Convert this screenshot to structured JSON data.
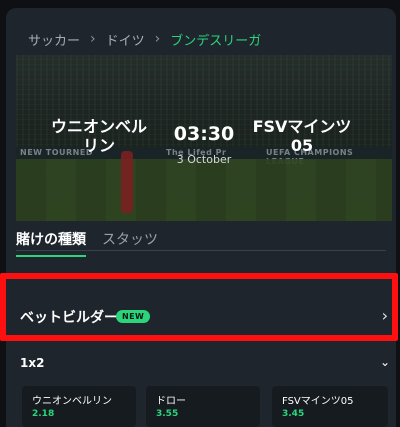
{
  "breadcrumb": {
    "items": [
      "サッカー",
      "ドイツ",
      "ブンデスリーガ"
    ],
    "separator": "›"
  },
  "match": {
    "home_team_line1": "ウニオンベル",
    "home_team_line2": "リン",
    "away_team_line1": "FSVマインツ",
    "away_team_line2": "05",
    "time": "03:30",
    "date": "3 October",
    "ads": [
      "NEW TOURNED",
      "The Lifed Pr",
      "UEFA CHAMPIONS LEAGUE"
    ]
  },
  "tabs": [
    {
      "label": "賭けの種類",
      "active": true
    },
    {
      "label": "スタッツ",
      "active": false
    }
  ],
  "bet_builder": {
    "label": "ベットビルダー",
    "badge": "NEW",
    "chevron": "›"
  },
  "market": {
    "title": "1x2",
    "chevron": "⌄",
    "selections": [
      {
        "name": "ウニオンベルリン",
        "price": "2.18"
      },
      {
        "name": "ドロー",
        "price": "3.55"
      },
      {
        "name": "FSVマインツ05",
        "price": "3.45"
      }
    ]
  },
  "colors": {
    "accent": "#2ad57b",
    "highlight": "#ff1010",
    "panel": "#1f252c",
    "background": "#0e1013"
  }
}
